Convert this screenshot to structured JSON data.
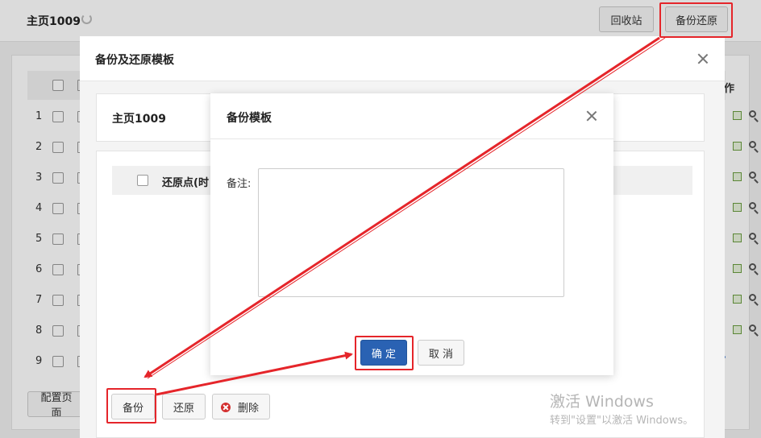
{
  "header": {
    "title": "主页1009",
    "recycle_label": "回收站",
    "backup_restore_label": "备份还原"
  },
  "background_table": {
    "column_op": "作",
    "rows": [
      "1",
      "2",
      "3",
      "4",
      "5",
      "6",
      "7",
      "8",
      "9"
    ],
    "config_label": "配置页面"
  },
  "outer_modal": {
    "title": "备份及还原模板",
    "panel_title": "主页1009",
    "table_header": "还原点(时",
    "backup_label": "备份",
    "restore_label": "还原",
    "delete_label": "删除"
  },
  "inner_modal": {
    "title": "备份模板",
    "remark_label": "备注:",
    "remark_value": "",
    "confirm_label": "确 定",
    "cancel_label": "取 消"
  },
  "watermark": {
    "line1": "激活 Windows",
    "line2": "转到\"设置\"以激活 Windows。"
  },
  "colors": {
    "primary": "#2a62b3",
    "annotation": "#e5252a",
    "delete": "#d32f2f"
  }
}
